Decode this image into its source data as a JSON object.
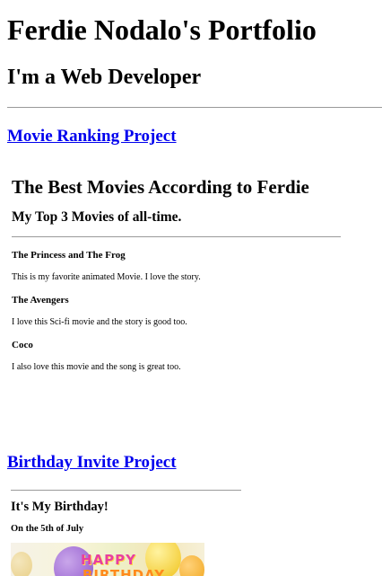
{
  "header": {
    "title": "Ferdie Nodalo's Portfolio",
    "subtitle": "I'm a Web Developer"
  },
  "projects": [
    {
      "link_label": "Movie Ranking Project",
      "frame": {
        "title": "The Best Movies According to Ferdie",
        "subtitle": "My Top 3 Movies of all-time.",
        "movies": [
          {
            "name": "The Princess and The Frog",
            "description": "This is my favorite animated Movie. I love the story."
          },
          {
            "name": "The Avengers",
            "description": "I love this Sci-fi movie and the story is good too."
          },
          {
            "name": "Coco",
            "description": "I also love this movie and the song is great too."
          }
        ]
      }
    },
    {
      "link_label": "Birthday Invite Project",
      "frame": {
        "title": "It's My Birthday!",
        "date": "On the 5th of July",
        "image_text_line1": "HAPPY",
        "image_text_line2": "BIRTHDAY"
      }
    }
  ],
  "colors": {
    "link": "#0000ee",
    "rule": "#9a9a9a",
    "background": "#ffffff"
  }
}
